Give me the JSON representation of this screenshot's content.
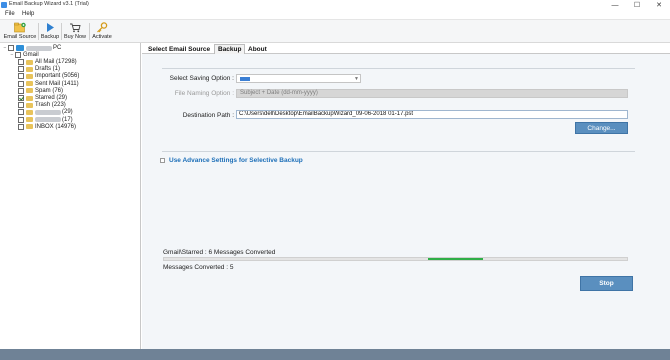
{
  "window": {
    "title": "Email Backup Wizard v3.1 (Trial)",
    "controls": {
      "minimize": "—",
      "maximize": "☐",
      "close": "✕"
    }
  },
  "menu": {
    "file": "File",
    "help": "Help"
  },
  "toolbar": {
    "email_source": "Email Source",
    "backup": "Backup",
    "buy_now": "Buy Now",
    "activate": "Activate"
  },
  "tree": {
    "root_label": "PC",
    "account": "Gmail",
    "folders": [
      {
        "label": "All Mail (17298)",
        "checked": false
      },
      {
        "label": "Drafts (1)",
        "checked": false
      },
      {
        "label": "Important (5056)",
        "checked": false
      },
      {
        "label": "Sent Mail (1411)",
        "checked": false
      },
      {
        "label": "Spam (76)",
        "checked": false
      },
      {
        "label": "Starred (29)",
        "checked": true
      },
      {
        "label": "Trash (223)",
        "checked": false
      },
      {
        "label": "(29)",
        "checked": false,
        "masked": true
      },
      {
        "label": "(17)",
        "checked": false,
        "masked": true
      },
      {
        "label": "INBOX (14976)",
        "checked": false
      }
    ]
  },
  "tabs": [
    "Select Email Source",
    "Backup",
    "About"
  ],
  "active_tab": "Backup",
  "form": {
    "saving_option_label": "Select Saving Option :",
    "file_naming_label": "File Naming Option :",
    "file_naming_value": "Subject + Date (dd-mm-yyyy)",
    "destination_label": "Destination Path :",
    "destination_value": "C:\\Users\\dell\\Desktop\\EmailBackupWizard_09-06-2018 01-17.pst",
    "change_button": "Change..."
  },
  "advance": {
    "label": "Use Advance Settings for Selective Backup"
  },
  "status": {
    "current": "Gmail\\Starred : 6 Messages Converted",
    "converted": "Messages Converted : 5",
    "progress_start": 0.57,
    "progress_end": 0.69
  },
  "stop_button": "Stop",
  "colors": {
    "accent": "#5a8fbf",
    "progress": "#2fae47",
    "statusbar": "#6f8296",
    "link": "#1d6fb8"
  }
}
